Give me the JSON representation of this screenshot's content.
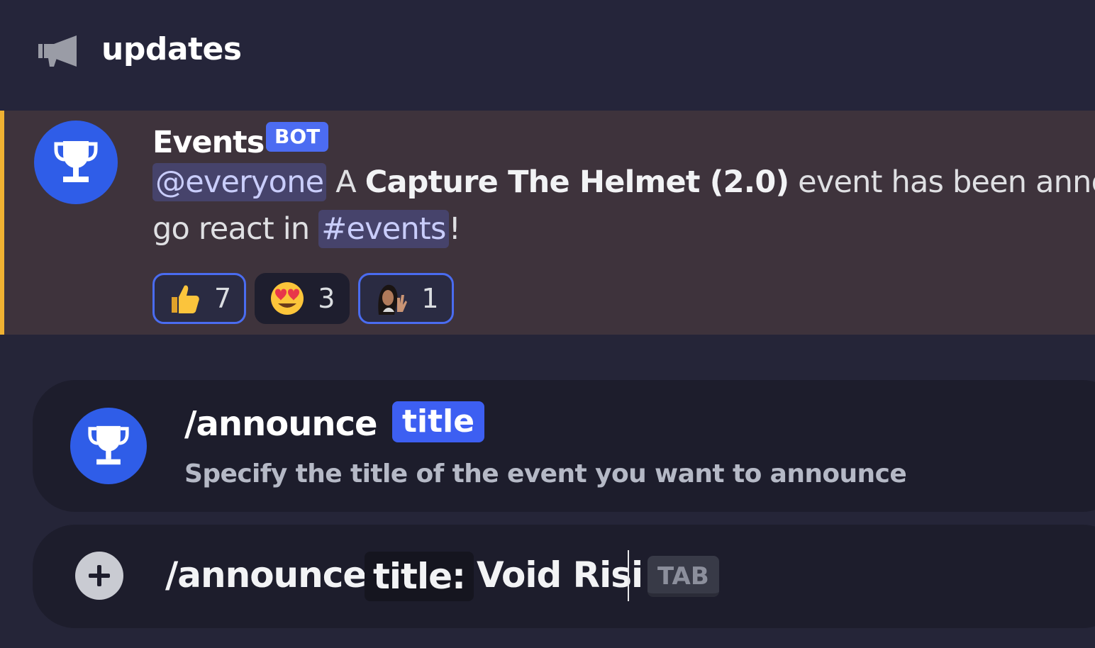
{
  "header": {
    "icon": "megaphone-icon",
    "channel_name": "updates"
  },
  "message": {
    "author": "Events",
    "bot_tag": "BOT",
    "avatar_icon": "trophy-icon",
    "accent_color": "#f0b232",
    "mention": "@everyone",
    "text_a": "A",
    "event_name": "Capture The Helmet (2.0)",
    "text_b": "event has been anno",
    "text_c": "go react in",
    "channel_mention": "#events",
    "text_d": "!",
    "reactions": [
      {
        "emoji": "thumbs-up",
        "count": "7",
        "active": true
      },
      {
        "emoji": "heart-eyes",
        "count": "3",
        "active": false
      },
      {
        "emoji": "custom-waving-person",
        "count": "1",
        "active": true
      }
    ]
  },
  "command_popup": {
    "avatar_icon": "trophy-icon",
    "command": "/announce",
    "option": "title",
    "description": "Specify the title of the event you want to announce"
  },
  "input": {
    "plus_icon": "plus-icon",
    "command": "/announce",
    "option_label": "title:",
    "value": "Void Risi",
    "tab_hint": "TAB"
  },
  "colors": {
    "brand_blue": "#3d5ff2",
    "mention_bg": "#46436b"
  }
}
